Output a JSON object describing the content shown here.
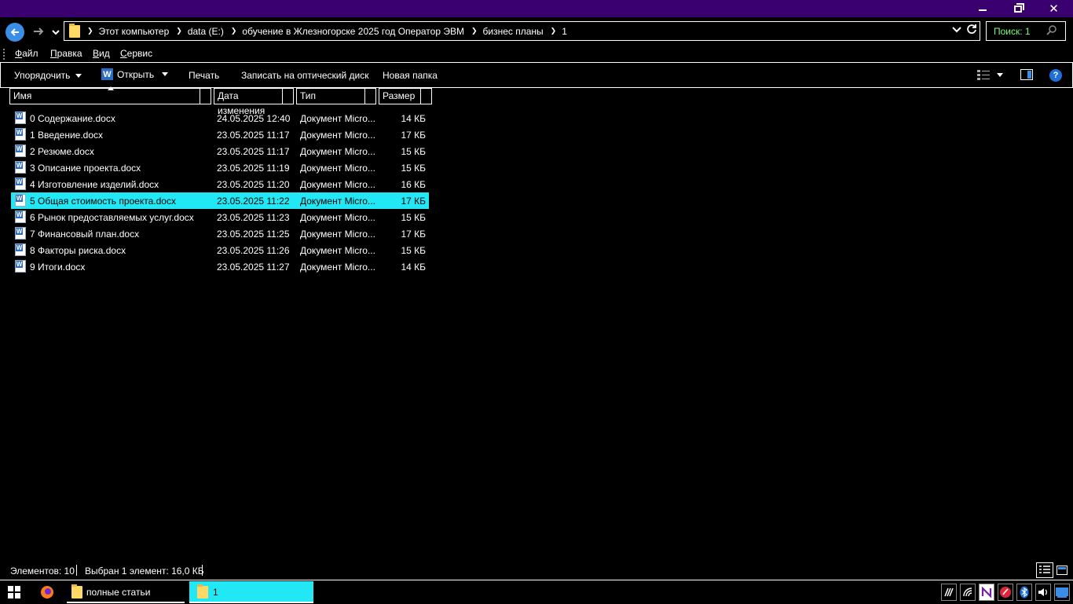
{
  "window": {
    "minimize_icon": "minimize-icon",
    "maximize_icon": "restore-icon",
    "close_icon": "close-icon",
    "close_glyph": "✕"
  },
  "navigation": {
    "back_icon": "back-arrow-icon",
    "forward_icon": "forward-arrow-icon",
    "recent_icon": "chevron-down-icon",
    "breadcrumbs": [
      "Этот компьютер",
      "data (E:)",
      "обучение в Жлезногорске 2025 год Оператор ЭВМ",
      "бизнес планы",
      "1"
    ],
    "search_placeholder": "Поиск: 1"
  },
  "menu": {
    "items": [
      {
        "key": "Ф",
        "rest": "айл"
      },
      {
        "key": "П",
        "rest": "равка"
      },
      {
        "key": "В",
        "rest": "ид"
      },
      {
        "key": "С",
        "rest": "ервис"
      }
    ]
  },
  "toolbar": {
    "organize": "Упорядочить",
    "open": "Открыть",
    "print": "Печать",
    "burn": "Записать на оптический диск",
    "new_folder": "Новая папка",
    "help": "?"
  },
  "columns": {
    "name": "Имя",
    "date": "Дата изменения",
    "type": "Тип",
    "size": "Размер"
  },
  "files": [
    {
      "name": "0 Содержание.docx",
      "date": "24.05.2025 12:40",
      "type": "Документ Micro...",
      "size": "14 КБ",
      "selected": false
    },
    {
      "name": "1 Введение.docx",
      "date": "23.05.2025 11:17",
      "type": "Документ Micro...",
      "size": "17 КБ",
      "selected": false
    },
    {
      "name": "2 Резюме.docx",
      "date": "23.05.2025 11:17",
      "type": "Документ Micro...",
      "size": "15 КБ",
      "selected": false
    },
    {
      "name": "3 Описание проекта.docx",
      "date": "23.05.2025 11:19",
      "type": "Документ Micro...",
      "size": "15 КБ",
      "selected": false
    },
    {
      "name": "4 Изготовление изделий.docx",
      "date": "23.05.2025 11:20",
      "type": "Документ Micro...",
      "size": "16 КБ",
      "selected": false
    },
    {
      "name": "5 Общая стоимость проекта.docx",
      "date": "23.05.2025 11:22",
      "type": "Документ Micro...",
      "size": "17 КБ",
      "selected": true
    },
    {
      "name": "6 Рынок предоставляемых услуг.docx",
      "date": "23.05.2025 11:23",
      "type": "Документ Micro...",
      "size": "15 КБ",
      "selected": false
    },
    {
      "name": "7 Финансовый план.docx",
      "date": "23.05.2025 11:25",
      "type": "Документ Micro...",
      "size": "17 КБ",
      "selected": false
    },
    {
      "name": "8 Факторы риска.docx",
      "date": "23.05.2025 11:26",
      "type": "Документ Micro...",
      "size": "15 КБ",
      "selected": false
    },
    {
      "name": "9 Итоги.docx",
      "date": "23.05.2025 11:27",
      "type": "Документ Micro...",
      "size": "14 КБ",
      "selected": false
    }
  ],
  "status": {
    "items_count": "Элементов: 10",
    "selection": "Выбран 1 элемент: 16,0 КБ"
  },
  "taskbar": {
    "apps": [
      {
        "label": "полные статьи",
        "active": false
      },
      {
        "label": "1",
        "active": true
      }
    ]
  },
  "colors": {
    "titlebar": "#3a0070",
    "selection": "#22e8f5",
    "search_text": "#7CFC7C"
  }
}
